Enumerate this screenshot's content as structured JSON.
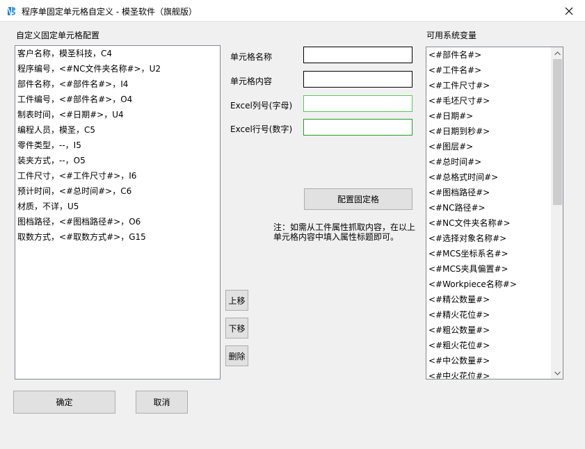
{
  "window": {
    "title": "程序单固定单元格自定义 - 模圣软件（旗舰版）"
  },
  "left_panel": {
    "label": "自定义固定单元格配置",
    "items": [
      "客户名称，模圣科技，C4",
      "程序编号，<#NC文件夹名称#>，U2",
      "部件名称，<#部件名#>，I4",
      "工件编号，<#部件名#>，O4",
      "制表时间，<#日期#>，U4",
      "编程人员，模圣，C5",
      "零件类型，--，I5",
      "装夹方式，--，O5",
      "工件尺寸，<#工件尺寸#>，I6",
      "预计时间，<#总时间#>，C6",
      "材质，不详，U5",
      "图档路径，<#图档路径#>，O6",
      "取数方式，<#取数方式#>，G15"
    ]
  },
  "form": {
    "cell_name_label": "单元格名称",
    "cell_content_label": "单元格内容",
    "excel_col_label": "Excel列号(字母)",
    "excel_row_label": "Excel行号(数字)",
    "cell_name_value": "",
    "cell_content_value": "",
    "excel_col_value": "",
    "excel_row_value": "",
    "config_button": "配置固定格",
    "note_line1": "注：如需从工件属性抓取内容，在以上",
    "note_line2": "单元格内容中填入属性标题即可。"
  },
  "move_buttons": {
    "up": "上移",
    "down": "下移",
    "delete": "删除"
  },
  "right_panel": {
    "label": "可用系统变量",
    "items": [
      "<#部件名#>",
      "<#工件名#>",
      "<#工件尺寸#>",
      "<#毛坯尺寸#>",
      "<#日期#>",
      "<#日期到秒#>",
      "<#图层#>",
      "<#总时间#>",
      "<#总格式时间#>",
      "<#图档路径#>",
      "<#NC路径#>",
      "<#NC文件夹名称#>",
      "<#选择对象名称#>",
      "<#MCS坐标系名#>",
      "<#MCS夹具偏置#>",
      "<#Workpiece名称#>",
      "<#精公数量#>",
      "<#精火花位#>",
      "<#粗公数量#>",
      "<#粗火花位#>",
      "<#中公数量#>",
      "<#中火花位#>"
    ]
  },
  "footer": {
    "ok": "确定",
    "cancel": "取消"
  },
  "colors": {
    "accent_green_light": "#59c859",
    "accent_green_dark": "#219b21",
    "button_bg": "#e1e1e1",
    "list_border": "#828790"
  }
}
